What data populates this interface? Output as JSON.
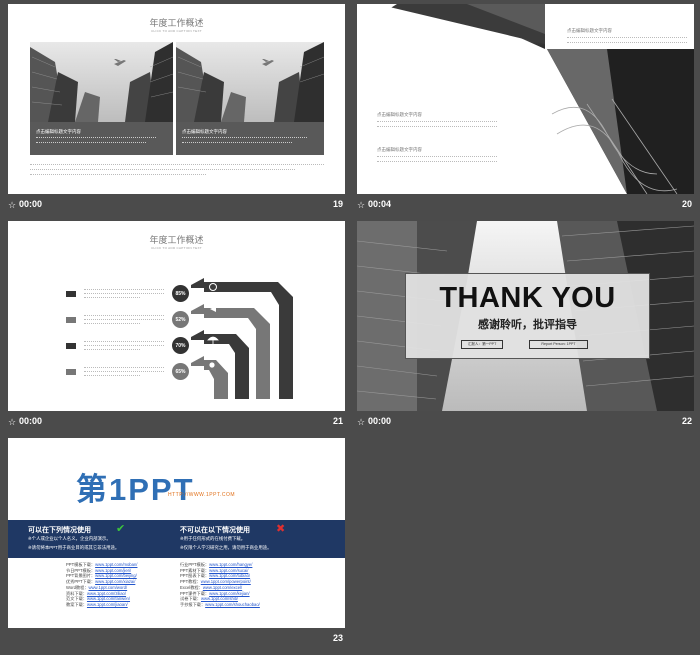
{
  "slides": [
    {
      "time": "00:00",
      "number": "19",
      "title": "年度工作概述",
      "subtitle": "CLICK TO ADD CAPTION TEXT",
      "cards": [
        {
          "heading": "点击编辑标题文字内容"
        },
        {
          "heading": "点击编辑标题文字内容"
        }
      ]
    },
    {
      "time": "00:04",
      "number": "20",
      "blocks": [
        {
          "heading": "点击编辑标题文字内容"
        },
        {
          "heading": "点击编辑标题文字内容"
        },
        {
          "heading": "点击编辑标题文字内容"
        }
      ]
    },
    {
      "time": "00:00",
      "number": "21",
      "title": "年度工作概述",
      "subtitle": "CLICK TO ADD CAPTION TEXT",
      "rows": [
        {
          "percent": "85%"
        },
        {
          "percent": "52%"
        },
        {
          "percent": "70%"
        },
        {
          "percent": "65%"
        }
      ]
    },
    {
      "time": "00:00",
      "number": "22",
      "headline": "THANK YOU",
      "tagline": "感谢聆听，批评指导",
      "btn1": "汇报人：第一PPT",
      "btn2": "Report Person: 1PPT"
    },
    {
      "number": "23",
      "logo_main": "第1PPT",
      "logo_url": "HTTP://WWW.1PPT.COM",
      "can_title": "可以在下列情况使用",
      "can_items": [
        "※个人或企业以个人名义，企业内部演示。",
        "※请勿将本PPT用于商业目的或其它非法用途。"
      ],
      "cannot_title": "不可以在以下情况使用",
      "cannot_items": [
        "※用于任何形式的在线付费下载。",
        "※仅限个人学习研究之用，请勿用于商业用途。"
      ],
      "links_left": [
        {
          "label": "PPT模板下载：",
          "url": "www.1ppt.com/moban/"
        },
        {
          "label": "节日PPT模板：",
          "url": "www.1ppt.com/jieri/"
        },
        {
          "label": "PPT背景图片：",
          "url": "www.1ppt.com/beijing/"
        },
        {
          "label": "优秀PPT下载：",
          "url": "www.1ppt.com/xiazai/"
        },
        {
          "label": "Word教程：",
          "url": "www.1ppt.com/word/"
        },
        {
          "label": "资料下载：",
          "url": "www.1ppt.com/ziliao/"
        },
        {
          "label": "范文下载：",
          "url": "www.1ppt.com/fanwen/"
        },
        {
          "label": "教案下载：",
          "url": "www.1ppt.com/jiaoan/"
        }
      ],
      "links_right": [
        {
          "label": "行业PPT模板：",
          "url": "www.1ppt.com/hangye/"
        },
        {
          "label": "PPT素材下载：",
          "url": "www.1ppt.com/sucai/"
        },
        {
          "label": "PPT图表下载：",
          "url": "www.1ppt.com/tubiao/"
        },
        {
          "label": "PPT教程：",
          "url": "www.1ppt.com/powerpoint/"
        },
        {
          "label": "Excel教程：",
          "url": "www.1ppt.com/excel/"
        },
        {
          "label": "PPT课件下载：",
          "url": "www.1ppt.com/kejian/"
        },
        {
          "label": "试卷下载：",
          "url": "www.1ppt.com/shiti/"
        },
        {
          "label": "手抄报下载：",
          "url": "www.1ppt.com/shouchaobao/"
        }
      ]
    }
  ],
  "colors": {
    "background": "#4b4b4b",
    "slide": "#ffffff",
    "banner": "#1f3864",
    "link": "#2255cc"
  },
  "icons": {
    "slide_star": "star-icon",
    "check": "check-icon",
    "cross": "cross-icon"
  }
}
